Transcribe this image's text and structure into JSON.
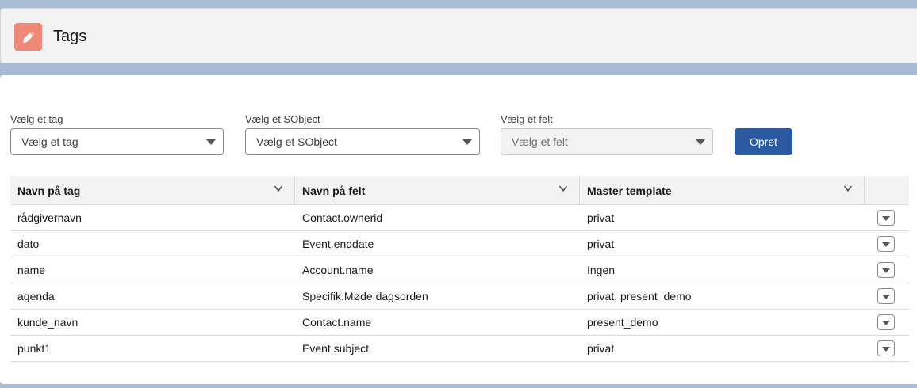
{
  "header": {
    "title": "Tags",
    "icon": "pencil-icon",
    "icon_color": "#f08a78"
  },
  "form": {
    "tag": {
      "label": "Vælg et tag",
      "placeholder": "Vælg et tag"
    },
    "sobject": {
      "label": "Vælg et SObject",
      "placeholder": "Vælg et SObject"
    },
    "field": {
      "label": "Vælg et felt",
      "placeholder": "Vælg et felt",
      "disabled": true
    },
    "create_label": "Opret",
    "accent": "#2b5aa0"
  },
  "table": {
    "columns": [
      "Navn på tag",
      "Navn på felt",
      "Master template"
    ],
    "rows": [
      {
        "tag": "rådgivernavn",
        "field": "Contact.ownerid",
        "template": "privat"
      },
      {
        "tag": "dato",
        "field": "Event.enddate",
        "template": "privat"
      },
      {
        "tag": "name",
        "field": "Account.name",
        "template": "Ingen"
      },
      {
        "tag": "agenda",
        "field": "Specifik.Møde dagsorden",
        "template": "privat, present_demo"
      },
      {
        "tag": "kunde_navn",
        "field": "Contact.name",
        "template": "present_demo"
      },
      {
        "tag": "punkt1",
        "field": "Event.subject",
        "template": "privat"
      }
    ]
  }
}
